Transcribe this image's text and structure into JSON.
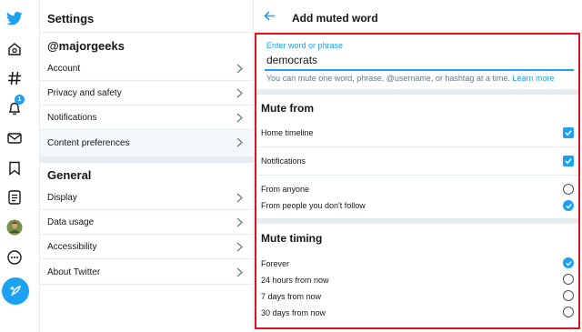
{
  "sidebar_nav": {
    "notification_badge": "1"
  },
  "settings": {
    "title": "Settings",
    "account_section": "@majorgeeks",
    "account_items": [
      {
        "label": "Account"
      },
      {
        "label": "Privacy and safety"
      },
      {
        "label": "Notifications"
      },
      {
        "label": "Content preferences"
      }
    ],
    "general_section": "General",
    "general_items": [
      {
        "label": "Display"
      },
      {
        "label": "Data usage"
      },
      {
        "label": "Accessibility"
      },
      {
        "label": "About Twitter"
      }
    ]
  },
  "panel": {
    "title": "Add muted word",
    "input": {
      "label": "Enter word or phrase",
      "value": "democrats",
      "help": "You can mute one word, phrase, @username, or hashtag at a time.",
      "learn_more": "Learn more"
    },
    "mute_from": {
      "title": "Mute from",
      "home_timeline": "Home timeline",
      "notifications": "Notifications",
      "from_anyone": "From anyone",
      "from_not_follow": "From people you don't follow"
    },
    "mute_timing": {
      "title": "Mute timing",
      "forever": "Forever",
      "h24": "24 hours from now",
      "d7": "7 days from now",
      "d30": "30 days from now"
    }
  },
  "colors": {
    "accent": "#1da1f2",
    "highlight_border": "#e0121f",
    "divider": "#e6ecf0"
  },
  "icons": [
    "twitter-bird-icon",
    "home-icon",
    "explore-hashtag-icon",
    "notifications-bell-icon",
    "messages-envelope-icon",
    "bookmarks-icon",
    "lists-icon",
    "profile-avatar-icon",
    "more-icon",
    "compose-tweet-icon",
    "back-arrow-icon",
    "chevron-right-icon"
  ]
}
